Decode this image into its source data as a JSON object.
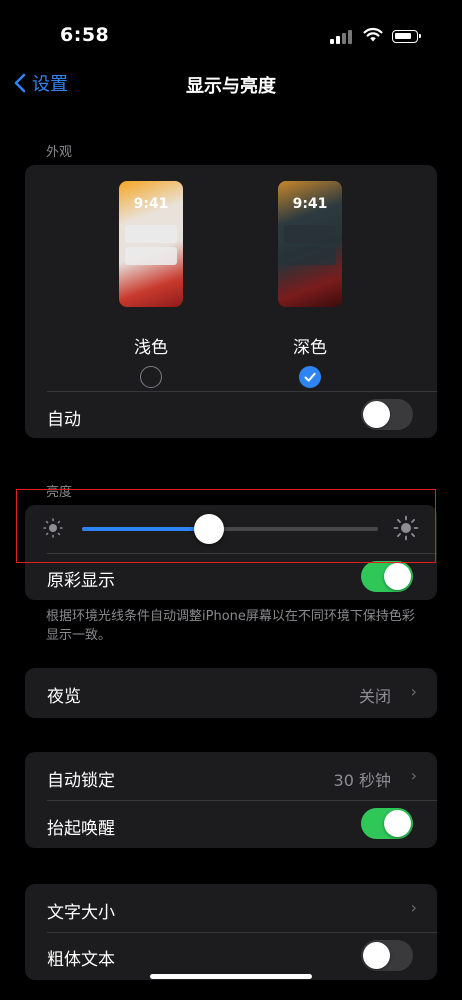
{
  "status_bar": {
    "time": "6:58"
  },
  "nav": {
    "back_label": "设置",
    "title": "显示与亮度"
  },
  "appearance": {
    "section_label": "外观",
    "light": {
      "label": "浅色",
      "preview_time": "9:41",
      "selected": false
    },
    "dark": {
      "label": "深色",
      "preview_time": "9:41",
      "selected": true
    },
    "auto_label": "自动",
    "auto_on": false
  },
  "brightness": {
    "section_label": "亮度",
    "level": 0.43,
    "true_tone_label": "原彩显示",
    "true_tone_on": true,
    "footnote": "根据环境光线条件自动调整iPhone屏幕以在不同环境下保持色彩显示一致。"
  },
  "night_shift": {
    "label": "夜览",
    "value": "关闭"
  },
  "lock": {
    "auto_lock_label": "自动锁定",
    "auto_lock_value": "30 秒钟",
    "raise_to_wake_label": "抬起唤醒",
    "raise_to_wake_on": true
  },
  "text": {
    "text_size_label": "文字大小",
    "bold_text_label": "粗体文本",
    "bold_text_on": false
  },
  "colors": {
    "accent": "#2f84f4",
    "toggle_on": "#30c759",
    "card": "#1c1c1e"
  }
}
